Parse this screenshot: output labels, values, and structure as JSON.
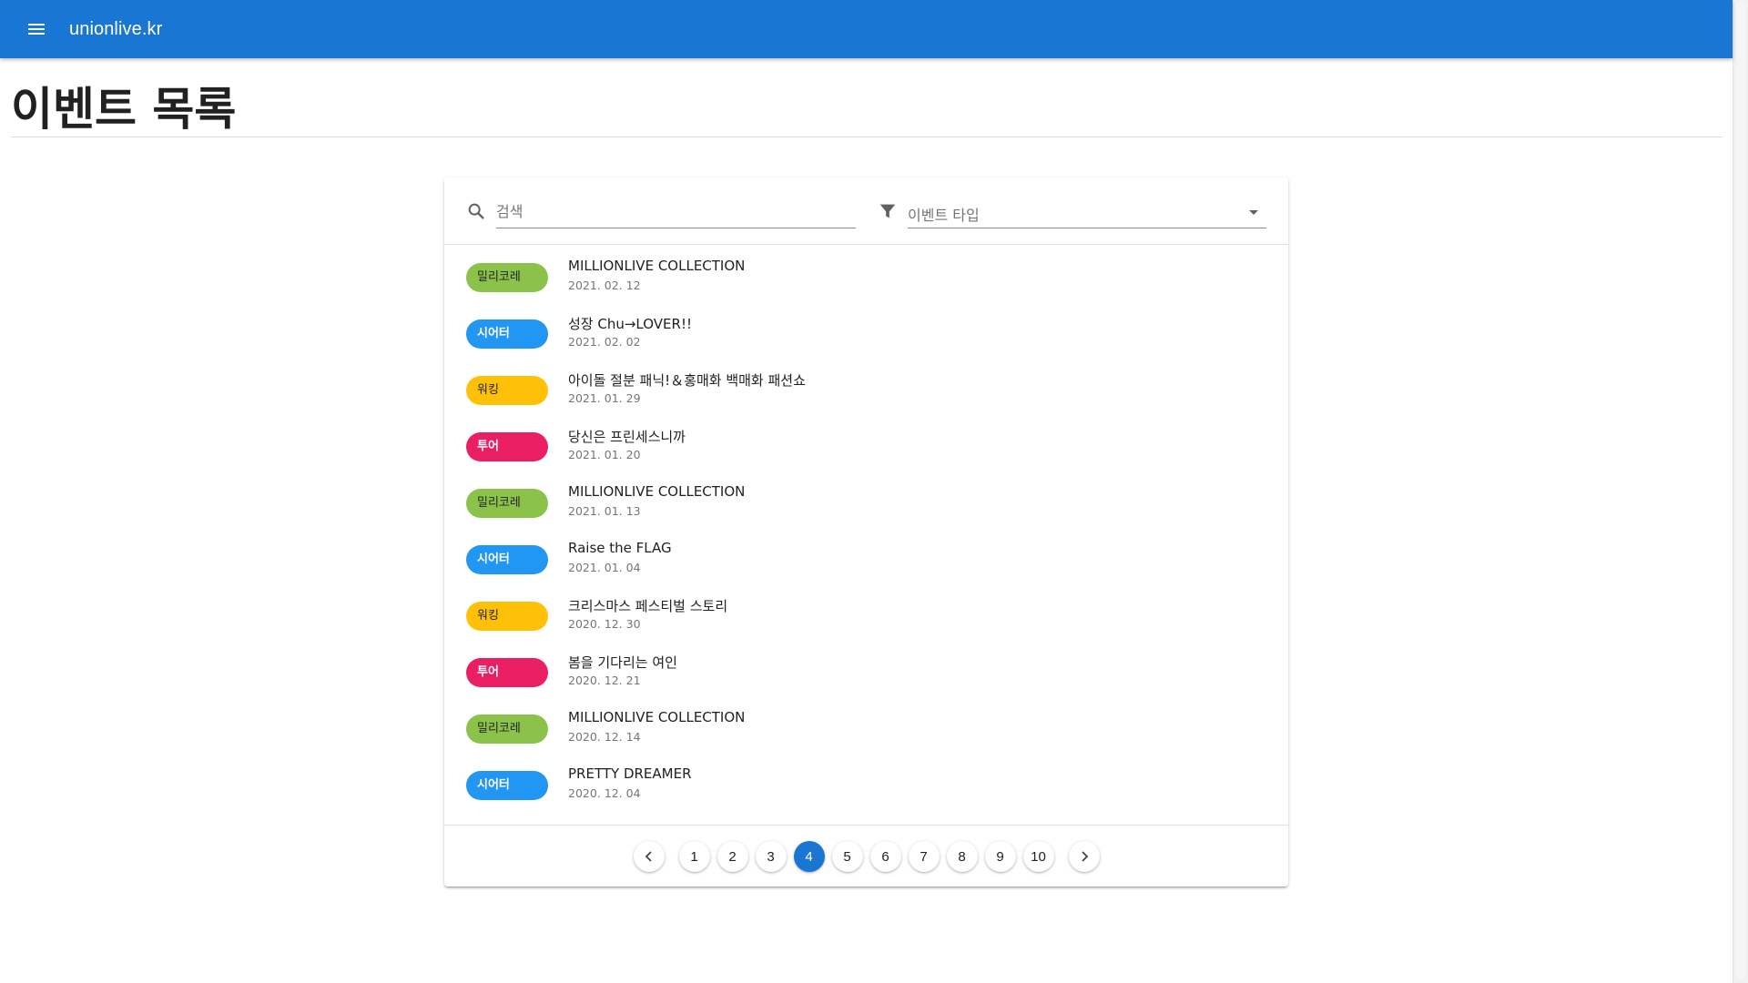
{
  "app": {
    "title": "unionlive.kr",
    "colors": {
      "primary": "#1976d2"
    }
  },
  "page": {
    "title": "이벤트 목록"
  },
  "filters": {
    "search_placeholder": "검색",
    "type_placeholder": "이벤트 타입",
    "icons": {
      "search": "search-icon",
      "filter": "filter-icon",
      "dropdown": "dropdown-arrow-icon"
    }
  },
  "events": [
    {
      "type": "밀리코레",
      "type_key": "milli",
      "title": "MILLIONLIVE COLLECTION",
      "date": "2021. 02. 12"
    },
    {
      "type": "시어터",
      "type_key": "theater",
      "title": "성장 Chu→LOVER!!",
      "date": "2021. 02. 02"
    },
    {
      "type": "워킹",
      "type_key": "working",
      "title": "아이돌 절분 패닉!＆홍매화 백매화 패션쇼",
      "date": "2021. 01. 29"
    },
    {
      "type": "투어",
      "type_key": "tour",
      "title": "당신은 프린세스니까",
      "date": "2021. 01. 20"
    },
    {
      "type": "밀리코레",
      "type_key": "milli",
      "title": "MILLIONLIVE COLLECTION",
      "date": "2021. 01. 13"
    },
    {
      "type": "시어터",
      "type_key": "theater",
      "title": "Raise the FLAG",
      "date": "2021. 01. 04"
    },
    {
      "type": "워킹",
      "type_key": "working",
      "title": "크리스마스 페스티벌 스토리",
      "date": "2020. 12. 30"
    },
    {
      "type": "투어",
      "type_key": "tour",
      "title": "봄을 기다리는 여인",
      "date": "2020. 12. 21"
    },
    {
      "type": "밀리코레",
      "type_key": "milli",
      "title": "MILLIONLIVE COLLECTION",
      "date": "2020. 12. 14"
    },
    {
      "type": "시어터",
      "type_key": "theater",
      "title": "PRETTY DREAMER",
      "date": "2020. 12. 04"
    }
  ],
  "badge_colors": {
    "milli": "#8bc34a",
    "theater": "#2196f3",
    "working": "#ffc107",
    "tour": "#e91e63"
  },
  "pagination": {
    "pages": [
      "1",
      "2",
      "3",
      "4",
      "5",
      "6",
      "7",
      "8",
      "9",
      "10"
    ],
    "current": "4"
  }
}
